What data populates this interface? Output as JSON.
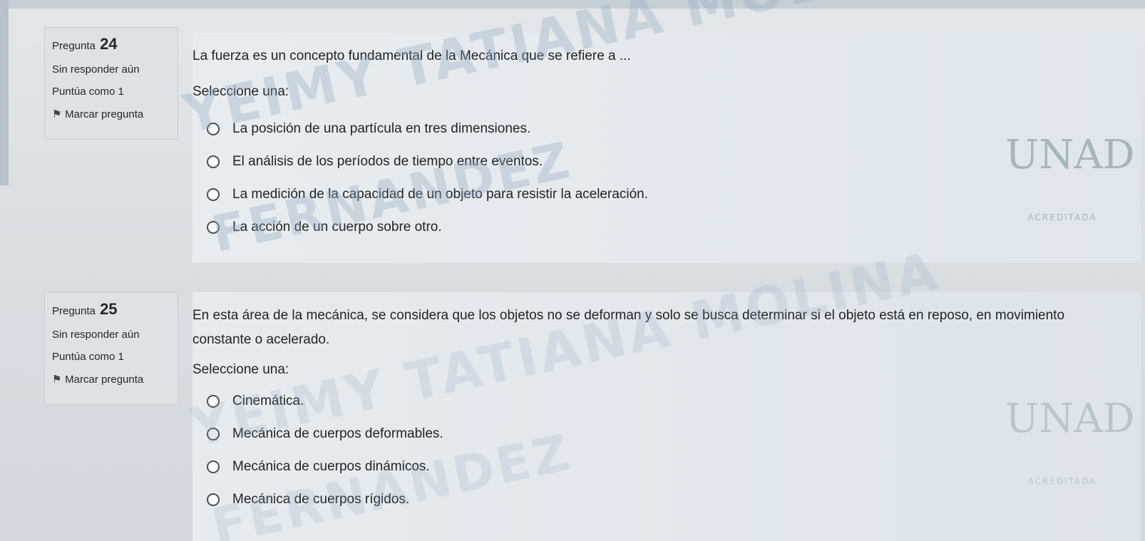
{
  "colors": {
    "background": "#d7dde3",
    "info_panel": "#dee2e6",
    "content_panel": "#e7ecf0",
    "text": "#1d2125",
    "watermark": "#96aabe"
  },
  "watermark": {
    "line1": "YEIMY TATIANA MOLINA",
    "line2": "FERNANDEZ"
  },
  "logo": {
    "brand": "UNAD",
    "accreditation": "ACREDITADA"
  },
  "questions": [
    {
      "label": "Pregunta",
      "number": "24",
      "status": "Sin responder aún",
      "score": "Puntúa como 1",
      "flag_label": "Marcar pregunta",
      "flag_icon": "flag-icon",
      "text": "La fuerza es un concepto fundamental de la Mecánica que se refiere a ...",
      "prompt": "Seleccione una:",
      "options": [
        "La posición de una partícula en tres dimensiones.",
        "El análisis de los períodos de tiempo entre eventos.",
        "La medición de la capacidad de un objeto para resistir la aceleración.",
        "La acción de un cuerpo sobre otro."
      ]
    },
    {
      "label": "Pregunta",
      "number": "25",
      "status": "Sin responder aún",
      "score": "Puntúa como 1",
      "flag_label": "Marcar pregunta",
      "flag_icon": "flag-icon",
      "text": "En esta área de la mecánica, se considera que los objetos no se deforman y solo se busca determinar si el objeto está en reposo, en movimiento constante o acelerado.",
      "prompt": "Seleccione una:",
      "options": [
        "Cinemática.",
        "Mecánica de cuerpos deformables.",
        "Mecánica de cuerpos dinámicos.",
        "Mecánica de cuerpos rígidos."
      ]
    }
  ]
}
